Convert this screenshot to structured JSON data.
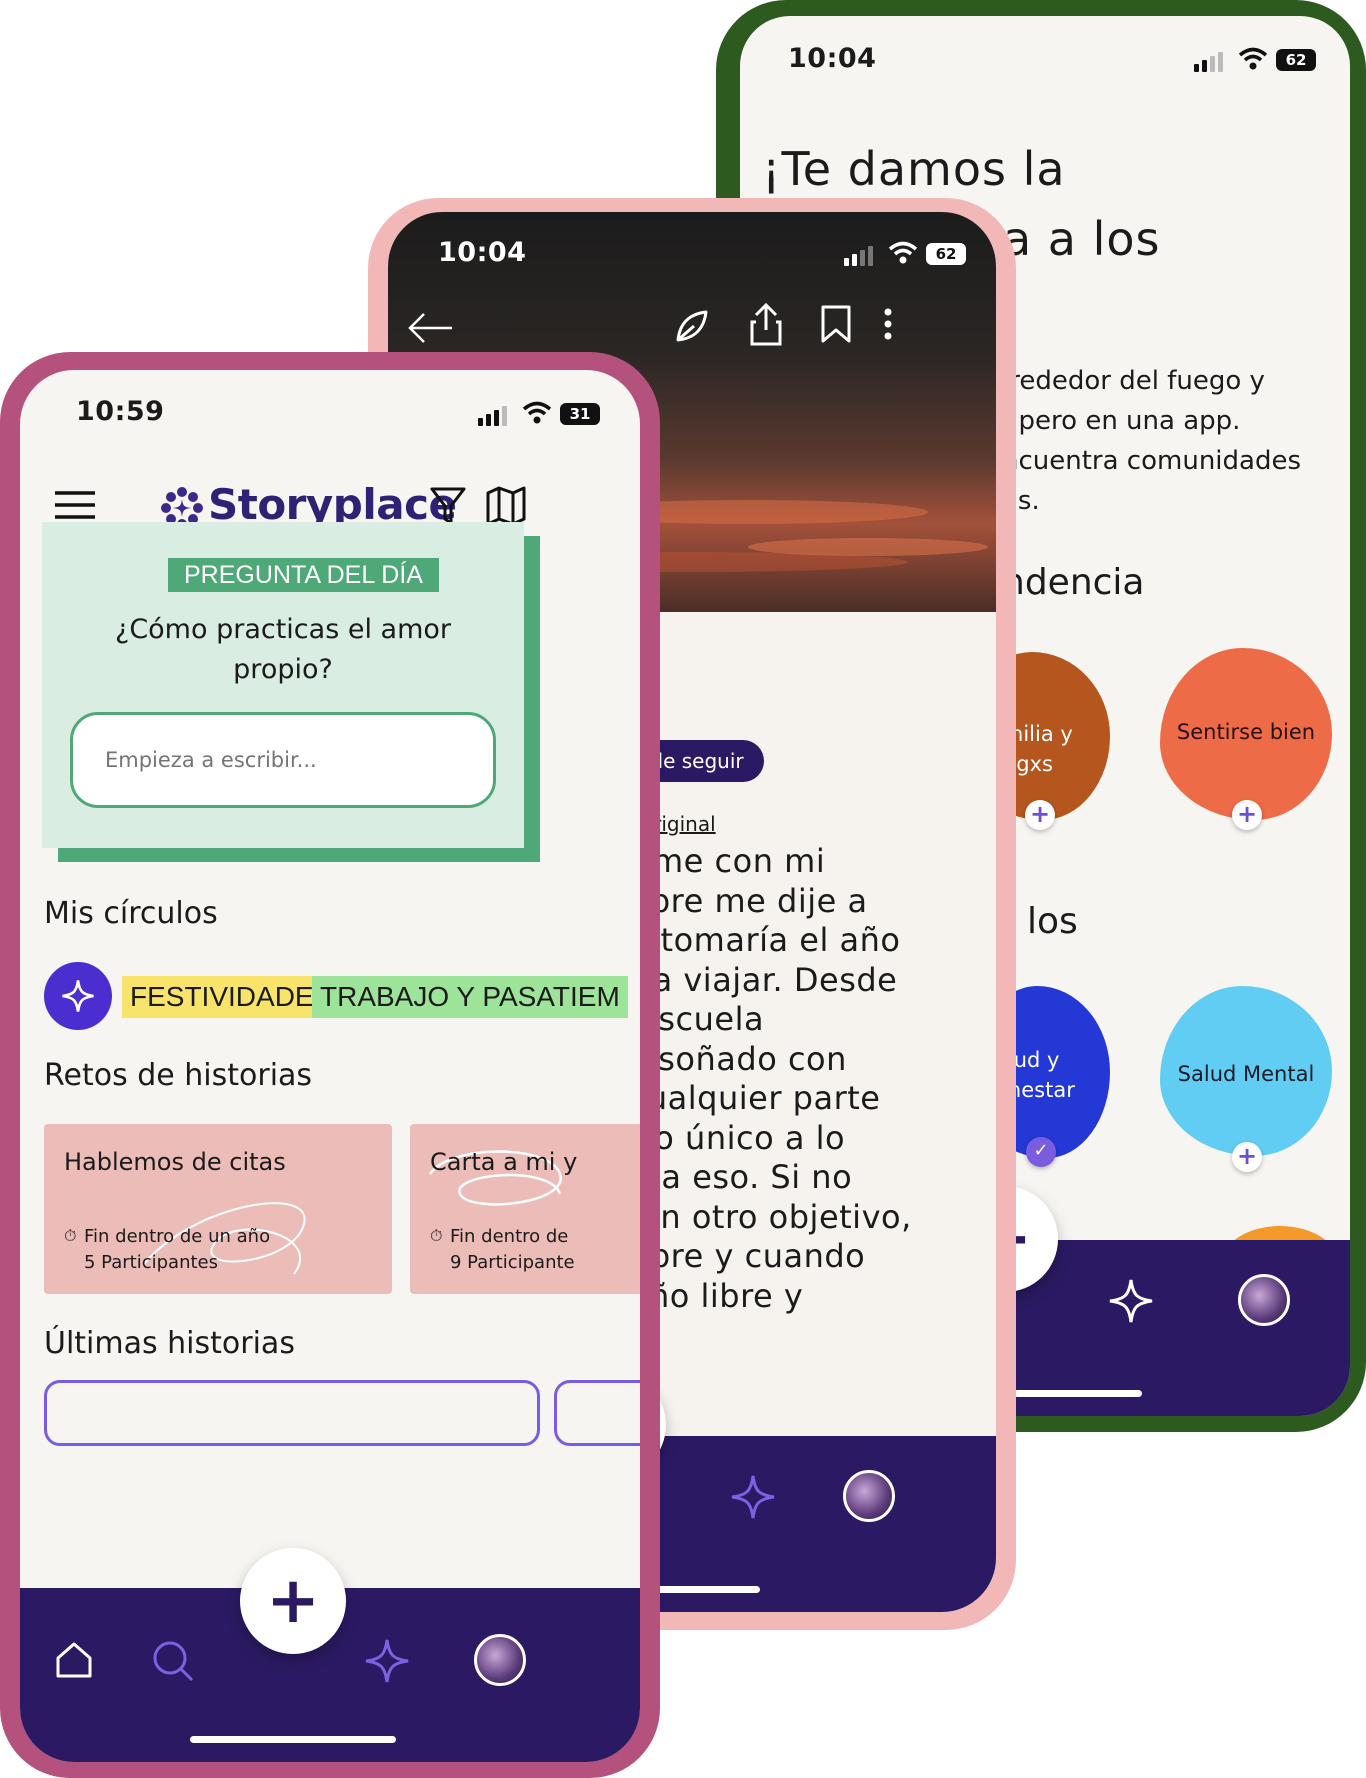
{
  "phone_back": {
    "status": {
      "time": "10:04",
      "battery": "62"
    },
    "heading_line1": "¡Te damos la",
    "heading_line2": "a a los",
    "paragraph": [
      "lrededor del fuego y",
      ", pero en una app.",
      "ncuentra comunidades",
      "as."
    ],
    "section1": "ndencia",
    "section2": "los",
    "bubbles": [
      {
        "label_line1": "amilia y",
        "label_line2": "migxs",
        "color": "#b5561f"
      },
      {
        "label_line1": "Sentirse bien",
        "label_line2": "",
        "color": "#ee6b47"
      },
      {
        "label_line1": "alud y",
        "label_line2": "enestar",
        "color": "#2438d6"
      },
      {
        "label_line1": "Salud Mental",
        "label_line2": "",
        "color": "#62cdf2"
      }
    ],
    "badge_plus": "+",
    "badge_check": "✓",
    "fab_label": "+"
  },
  "phone_mid": {
    "status": {
      "time": "10:04",
      "battery": "62"
    },
    "follow_button": "jar de seguir",
    "show_original": "trar original",
    "story_lines": [
      "uarme con mi",
      "empre me dije a",
      "me tomaría el año",
      "para viajar. Desde",
      "la escuela",
      "oía soñado con",
      " a cualquier parte",
      "s. Lo único a lo",
      "fue a eso. Si no",
      "ngún otro objetivo,",
      "empre y cuando",
      "e año libre y"
    ],
    "fab_label": "+"
  },
  "phone_front": {
    "status": {
      "time": "10:59",
      "battery": "31"
    },
    "brand": "Storyplace",
    "question_tag": "PREGUNTA DEL DÍA",
    "question_line1": "¿Cómo practicas el amor",
    "question_line2": "propio?",
    "answer_placeholder": "Empieza a escribir...",
    "circles_title": "Mis círculos",
    "circles": [
      {
        "label": "FESTIVIDADES",
        "color": "#f8e36b"
      },
      {
        "label": "TRABAJO Y PASATIEM",
        "color": "#9ee39a"
      }
    ],
    "challenges_title": "Retos de historias",
    "challenges": [
      {
        "title": "Hablemos de citas",
        "ends": "Fin dentro de un año",
        "participants": "5 Participantes"
      },
      {
        "title": "Carta a mi y",
        "ends": "Fin dentro de",
        "participants": "9 Participante"
      }
    ],
    "latest_title": "Últimas historias",
    "fab_label": "+"
  },
  "colors": {
    "nav_purple": "#2b1a63",
    "front_border": "#b4517d",
    "mid_border": "#f2b8b8",
    "back_border": "#2d5a1e",
    "question_green": "#4ea878",
    "challenge_pink": "#ecbcb8"
  },
  "icons": [
    "menu-icon",
    "storyplace-logo-icon",
    "filter-icon",
    "map-icon",
    "home-icon",
    "search-icon",
    "sparkle-icon",
    "back-arrow-icon",
    "send-icon",
    "share-icon",
    "bookmark-icon",
    "more-icon",
    "timer-icon",
    "wifi-icon",
    "signal-icon",
    "battery-icon"
  ]
}
